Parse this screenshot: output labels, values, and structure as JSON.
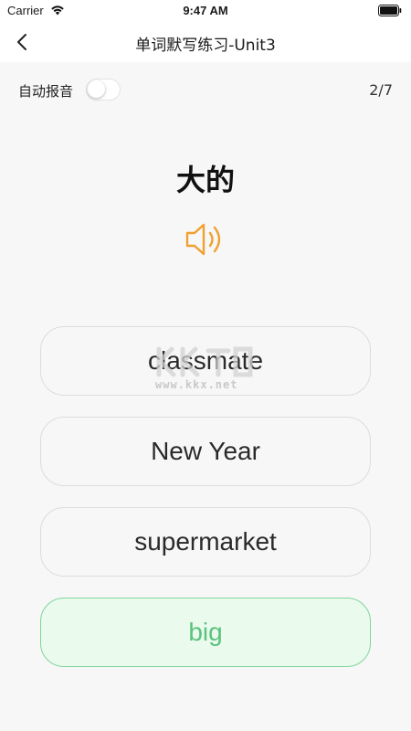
{
  "status_bar": {
    "carrier": "Carrier",
    "time": "9:47 AM",
    "wifi_icon": "wifi-icon",
    "battery_icon": "battery-icon"
  },
  "nav": {
    "back_icon": "chevron-left-icon",
    "title": "单词默写练习-Unit3"
  },
  "toolbar": {
    "auto_speak_label": "自动报音",
    "auto_speak_enabled": false,
    "progress": "2/7"
  },
  "question": {
    "word": "大的",
    "speaker_icon": "speaker-icon"
  },
  "options": [
    {
      "label": "classmate",
      "state": "default"
    },
    {
      "label": "New Year",
      "state": "default"
    },
    {
      "label": "supermarket",
      "state": "default"
    },
    {
      "label": "big",
      "state": "correct"
    }
  ],
  "watermark": {
    "text": "www.kkx.net"
  },
  "colors": {
    "accent_orange": "#f0a030",
    "correct_green": "#5cc27c",
    "correct_bg": "#eafbee",
    "correct_border": "#7fd49a",
    "background": "#f7f7f7"
  }
}
